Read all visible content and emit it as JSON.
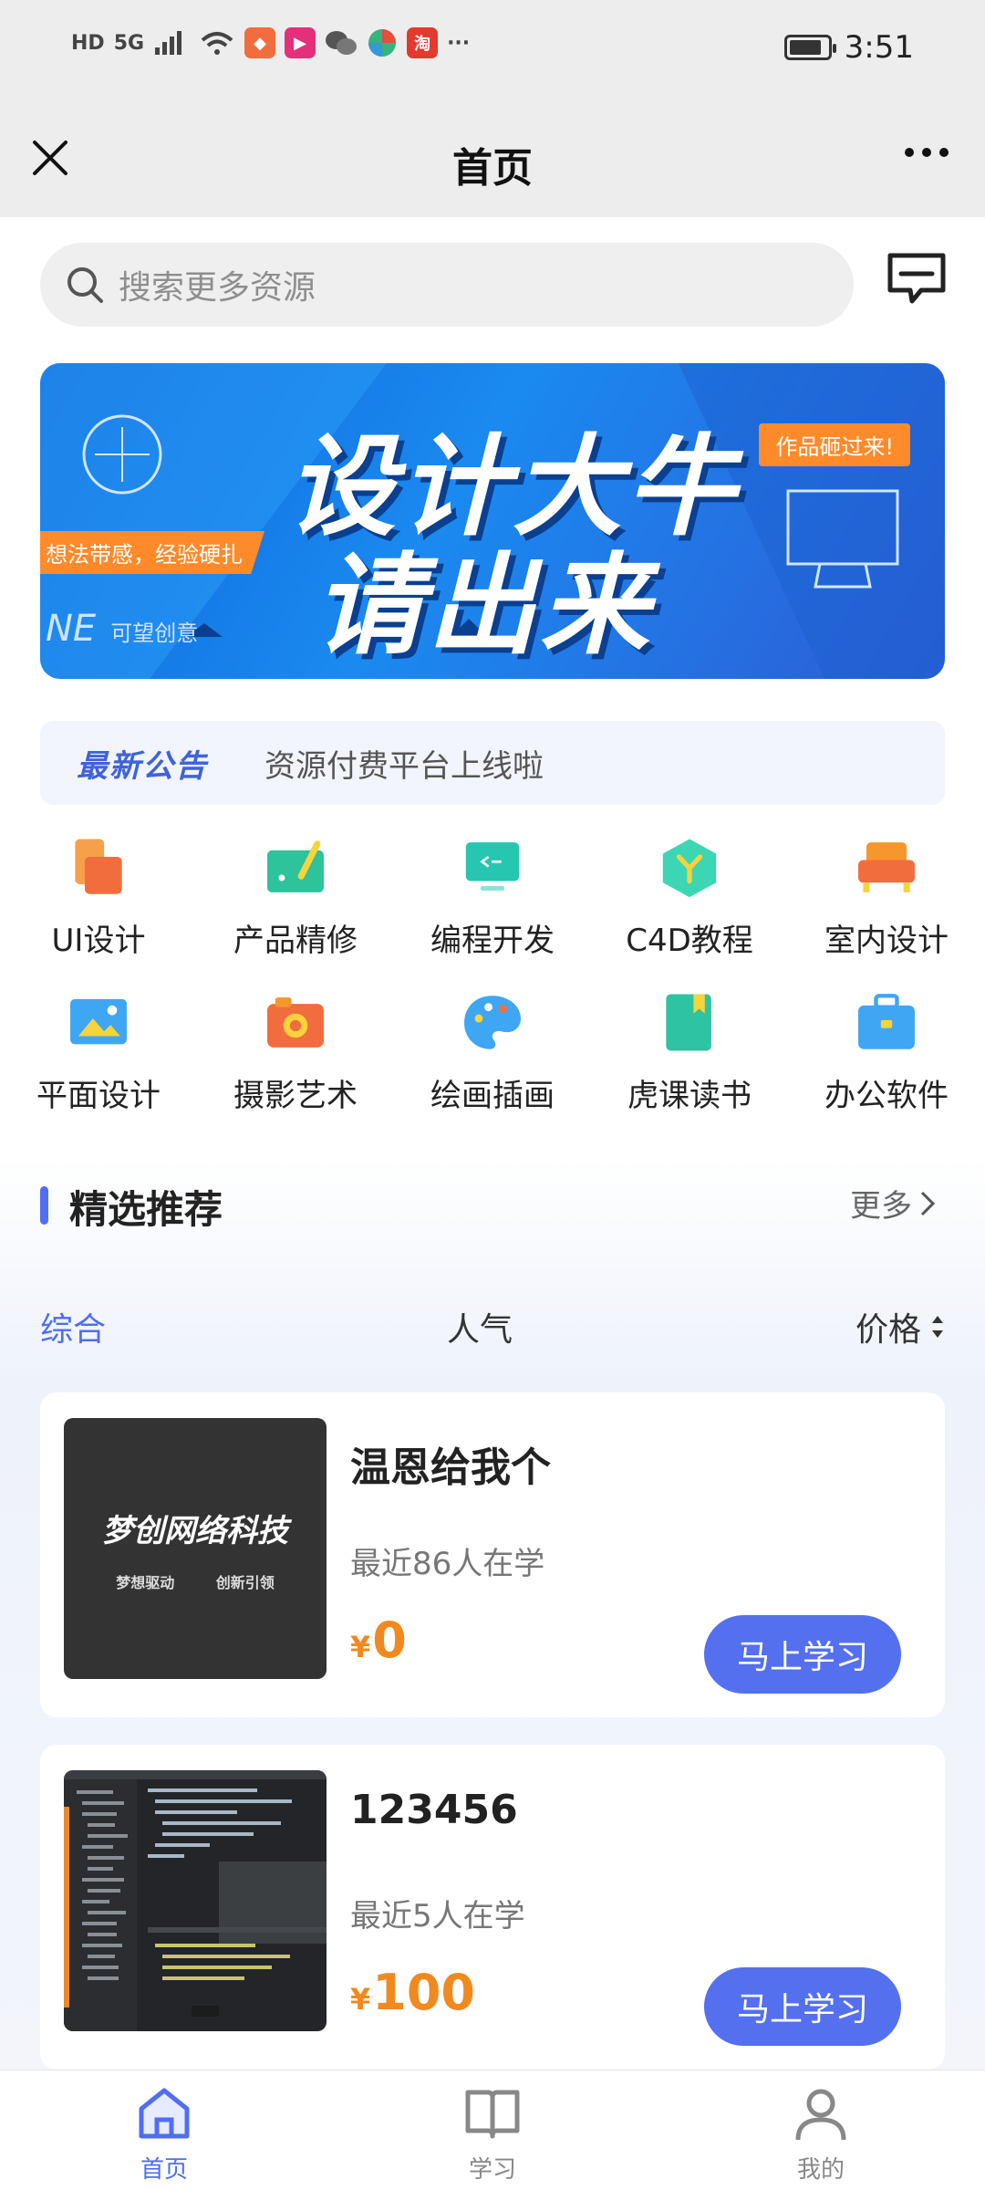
{
  "status_bar": {
    "network": "HD",
    "signal": "5G",
    "time": "3:51",
    "more": "···"
  },
  "header": {
    "title": "首页"
  },
  "search": {
    "placeholder": "搜索更多资源"
  },
  "banner": {
    "line1": "设计大牛",
    "line2": "请出来",
    "tag": "作品砸过来!",
    "strip": "想法带感，经验硬扎",
    "brand_prefix": "NE",
    "brand": "可望创意"
  },
  "notice": {
    "label": "最新公告",
    "text": "资源付费平台上线啦"
  },
  "categories": [
    {
      "label": "UI设计",
      "icon": "phone-icon",
      "color": "#f26d3d"
    },
    {
      "label": "产品精修",
      "icon": "pen-board-icon",
      "color": "#2ec39a"
    },
    {
      "label": "编程开发",
      "icon": "code-monitor-icon",
      "color": "#27c6b0"
    },
    {
      "label": "C4D教程",
      "icon": "cube-icon",
      "color": "#3dd6b4"
    },
    {
      "label": "室内设计",
      "icon": "sofa-icon",
      "color": "#f7962c"
    },
    {
      "label": "平面设计",
      "icon": "picture-icon",
      "color": "#3fa6f3"
    },
    {
      "label": "摄影艺术",
      "icon": "camera-icon",
      "color": "#f26d3d"
    },
    {
      "label": "绘画插画",
      "icon": "palette-icon",
      "color": "#3fa6f3"
    },
    {
      "label": "虎课读书",
      "icon": "book-icon",
      "color": "#2ec3a2"
    },
    {
      "label": "办公软件",
      "icon": "briefcase-icon",
      "color": "#3fa6f3"
    }
  ],
  "section": {
    "title": "精选推荐",
    "more": "更多"
  },
  "filters": {
    "all": "综合",
    "popular": "人气",
    "price": "价格"
  },
  "courses": [
    {
      "title": "温恩给我个",
      "learners": "最近86人在学",
      "currency": "¥",
      "price": "0",
      "button": "马上学习",
      "thumb_title": "梦创网络科技",
      "thumb_sub": "梦想驱动 创新引领"
    },
    {
      "title": "123456",
      "learners": "最近5人在学",
      "currency": "¥",
      "price": "100",
      "button": "马上学习"
    }
  ],
  "bottom_nav": [
    {
      "label": "首页",
      "icon": "home-icon",
      "active": true
    },
    {
      "label": "学习",
      "icon": "book-open-icon",
      "active": false
    },
    {
      "label": "我的",
      "icon": "user-icon",
      "active": false
    }
  ],
  "colors": {
    "accent": "#4f6ef2",
    "price": "#f08a1e",
    "banner": "#1a8af0"
  }
}
